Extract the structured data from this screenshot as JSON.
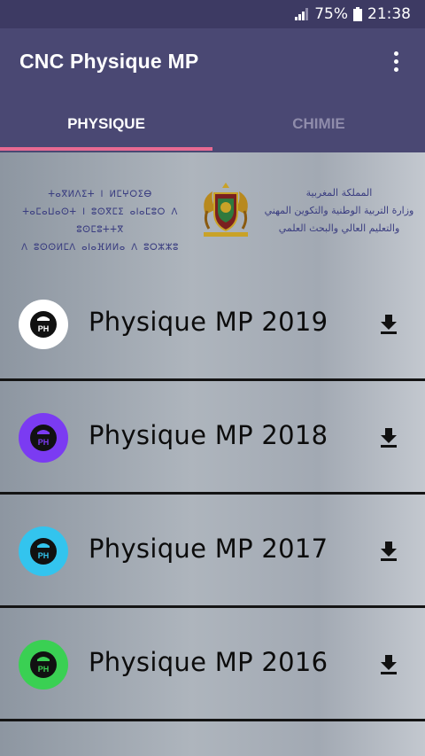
{
  "status_bar": {
    "battery": "75%",
    "time": "21:38",
    "signal_icon": "signal-icon",
    "battery_icon": "battery-icon"
  },
  "app_bar": {
    "title": "CNC Physique MP",
    "menu_icon": "more-vert-icon"
  },
  "tabs": [
    {
      "label": "PHYSIQUE",
      "selected": true
    },
    {
      "label": "CHIMIE",
      "selected": false
    }
  ],
  "colors": {
    "app_bar": "#4a4873",
    "status_bar": "#3d3a63",
    "indicator": "#e86a92"
  },
  "banner": {
    "tifinagh_lines": [
      "ⵜⴰⴳⵍⴷⵉⵜ ⵏ ⵍⵎⵖⵔⵉⴱ",
      "ⵜⴰⵎⴰⵡⴰⵙⵜ ⵏ ⵓⵙⴳⵎⵉ ⴰⵏⴰⵎⵓⵔ ⴷ ⵓⵙⵎⵓⵜⵜⴳ",
      "ⴷ ⵓⵙⵙⵍⵎⴷ ⴰⵏⴰⴼⵍⵍⴰ ⴷ ⵓⵔⵣⵣⵓ"
    ],
    "arabic_lines": [
      "المملكة المغربية",
      "وزارة التربية الوطنية والتكوين المهني",
      "والتعليم العالي والبحث العلمي"
    ],
    "emblem_icon": "moroccan-coat-of-arms-icon"
  },
  "items": [
    {
      "label": "Physique MP 2019",
      "badge_color": "#ffffff",
      "icon": "ph-flask-icon",
      "action_icon": "download-icon"
    },
    {
      "label": "Physique MP 2018",
      "badge_color": "#7b3bf2",
      "icon": "ph-flask-icon",
      "action_icon": "download-icon"
    },
    {
      "label": "Physique MP 2017",
      "badge_color": "#33c4ee",
      "icon": "ph-flask-icon",
      "action_icon": "download-icon"
    },
    {
      "label": "Physique MP 2016",
      "badge_color": "#3ad053",
      "icon": "ph-flask-icon",
      "action_icon": "download-icon"
    }
  ]
}
